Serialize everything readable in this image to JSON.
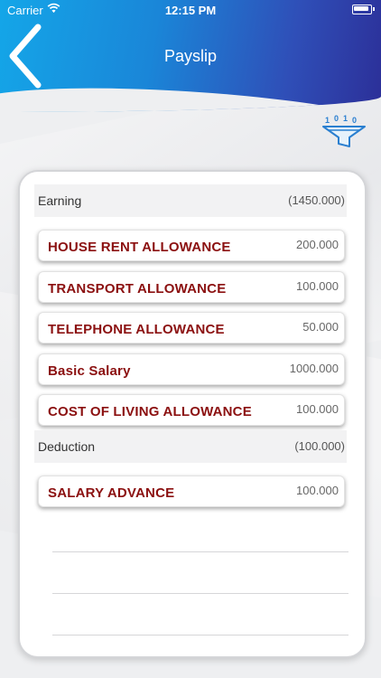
{
  "status_bar": {
    "carrier": "Carrier",
    "time": "12:15 PM"
  },
  "header": {
    "title": "Payslip"
  },
  "icons": {
    "back": "chevron-left-icon",
    "filter": "filter-icon"
  },
  "earning": {
    "label": "Earning",
    "total": "(1450.000)",
    "items": [
      {
        "label": "HOUSE RENT ALLOWANCE",
        "amount": "200.000"
      },
      {
        "label": "TRANSPORT ALLOWANCE",
        "amount": "100.000"
      },
      {
        "label": "TELEPHONE ALLOWANCE",
        "amount": "50.000"
      },
      {
        "label": "Basic Salary",
        "amount": "1000.000"
      },
      {
        "label": "COST OF LIVING ALLOWANCE",
        "amount": "100.000"
      }
    ]
  },
  "deduction": {
    "label": "Deduction",
    "total": "(100.000)",
    "items": [
      {
        "label": "SALARY ADVANCE",
        "amount": "100.000"
      }
    ]
  },
  "colors": {
    "header_start": "#14a6e8",
    "header_end": "#2c2f98",
    "item_label": "#8b1010"
  }
}
